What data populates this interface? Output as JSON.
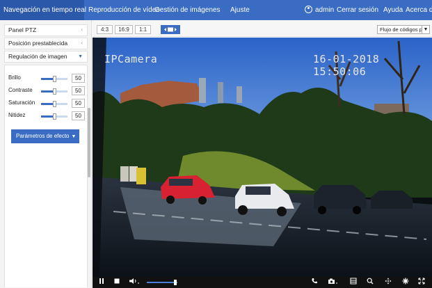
{
  "nav": {
    "items": [
      {
        "label": "Navegación en tiempo real",
        "active": true
      },
      {
        "label": "Reproducción de vídeo"
      },
      {
        "label": "Gestión de imágenes"
      },
      {
        "label": "Ajuste"
      }
    ],
    "user": "admin",
    "logout": "Cerrar sesión",
    "help": "Ayuda",
    "about": "Acerca de"
  },
  "sidebar": {
    "ptz": "Panel PTZ",
    "preset": "Posición prestablecida",
    "image_adjust": "Regulación de imagen",
    "sliders": [
      {
        "label": "Brillo",
        "value": "50",
        "fraction": 0.5
      },
      {
        "label": "Contraste",
        "value": "50",
        "fraction": 0.5
      },
      {
        "label": "Saturación",
        "value": "50",
        "fraction": 0.5
      },
      {
        "label": "Nitidez",
        "value": "50",
        "fraction": 0.5
      }
    ],
    "effect_button": "Parámetros de efecto"
  },
  "toolbar": {
    "ratios": [
      "4:3",
      "16:9",
      "1:1"
    ],
    "stream_select": "Flujo de códigos p"
  },
  "video": {
    "camera_name": "IPCamera",
    "timestamp": "16-01-2018 15:50:06"
  },
  "controls": {
    "volume_fraction": 0.9,
    "icons": [
      "pause-icon",
      "stop-icon",
      "volume-icon",
      "phone-icon",
      "snapshot-icon",
      "record-icon",
      "zoom-icon",
      "ptz-icon",
      "light-icon",
      "fullscreen-icon"
    ]
  },
  "colors": {
    "accent": "#3a6cc4",
    "nav_active": "#2b58a8"
  }
}
